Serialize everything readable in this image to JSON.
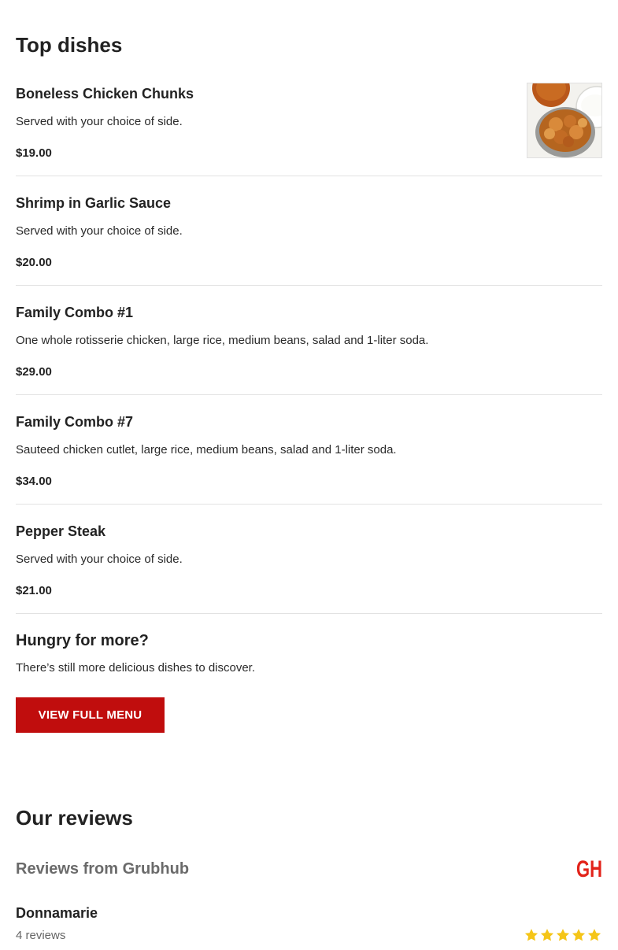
{
  "top_dishes": {
    "title": "Top dishes",
    "items": [
      {
        "name": "Boneless Chicken Chunks",
        "description": "Served with your choice of side.",
        "price": "$19.00",
        "has_image": true
      },
      {
        "name": "Shrimp in Garlic Sauce",
        "description": "Served with your choice of side.",
        "price": "$20.00"
      },
      {
        "name": "Family Combo #1",
        "description": "One whole rotisserie chicken, large rice, medium beans, salad and 1-liter soda.",
        "price": "$29.00"
      },
      {
        "name": "Family Combo #7",
        "description": "Sauteed chicken cutlet, large rice, medium beans, salad and 1-liter soda.",
        "price": "$34.00"
      },
      {
        "name": "Pepper Steak",
        "description": "Served with your choice of side.",
        "price": "$21.00"
      }
    ]
  },
  "more": {
    "title": "Hungry for more?",
    "description": "There’s still more delicious dishes to discover.",
    "button_label": "VIEW FULL MENU"
  },
  "reviews": {
    "title": "Our reviews",
    "source_label": "Reviews from Grubhub",
    "logo_text": "GH",
    "reviewer": {
      "name": "Donnamarie",
      "review_count": "4 reviews",
      "rating": 5
    }
  },
  "colors": {
    "accent": "#c00d0d",
    "star": "#f5c518",
    "logo": "#e2231a"
  },
  "icons": {
    "star": "star-icon",
    "logo": "grubhub-logo"
  }
}
